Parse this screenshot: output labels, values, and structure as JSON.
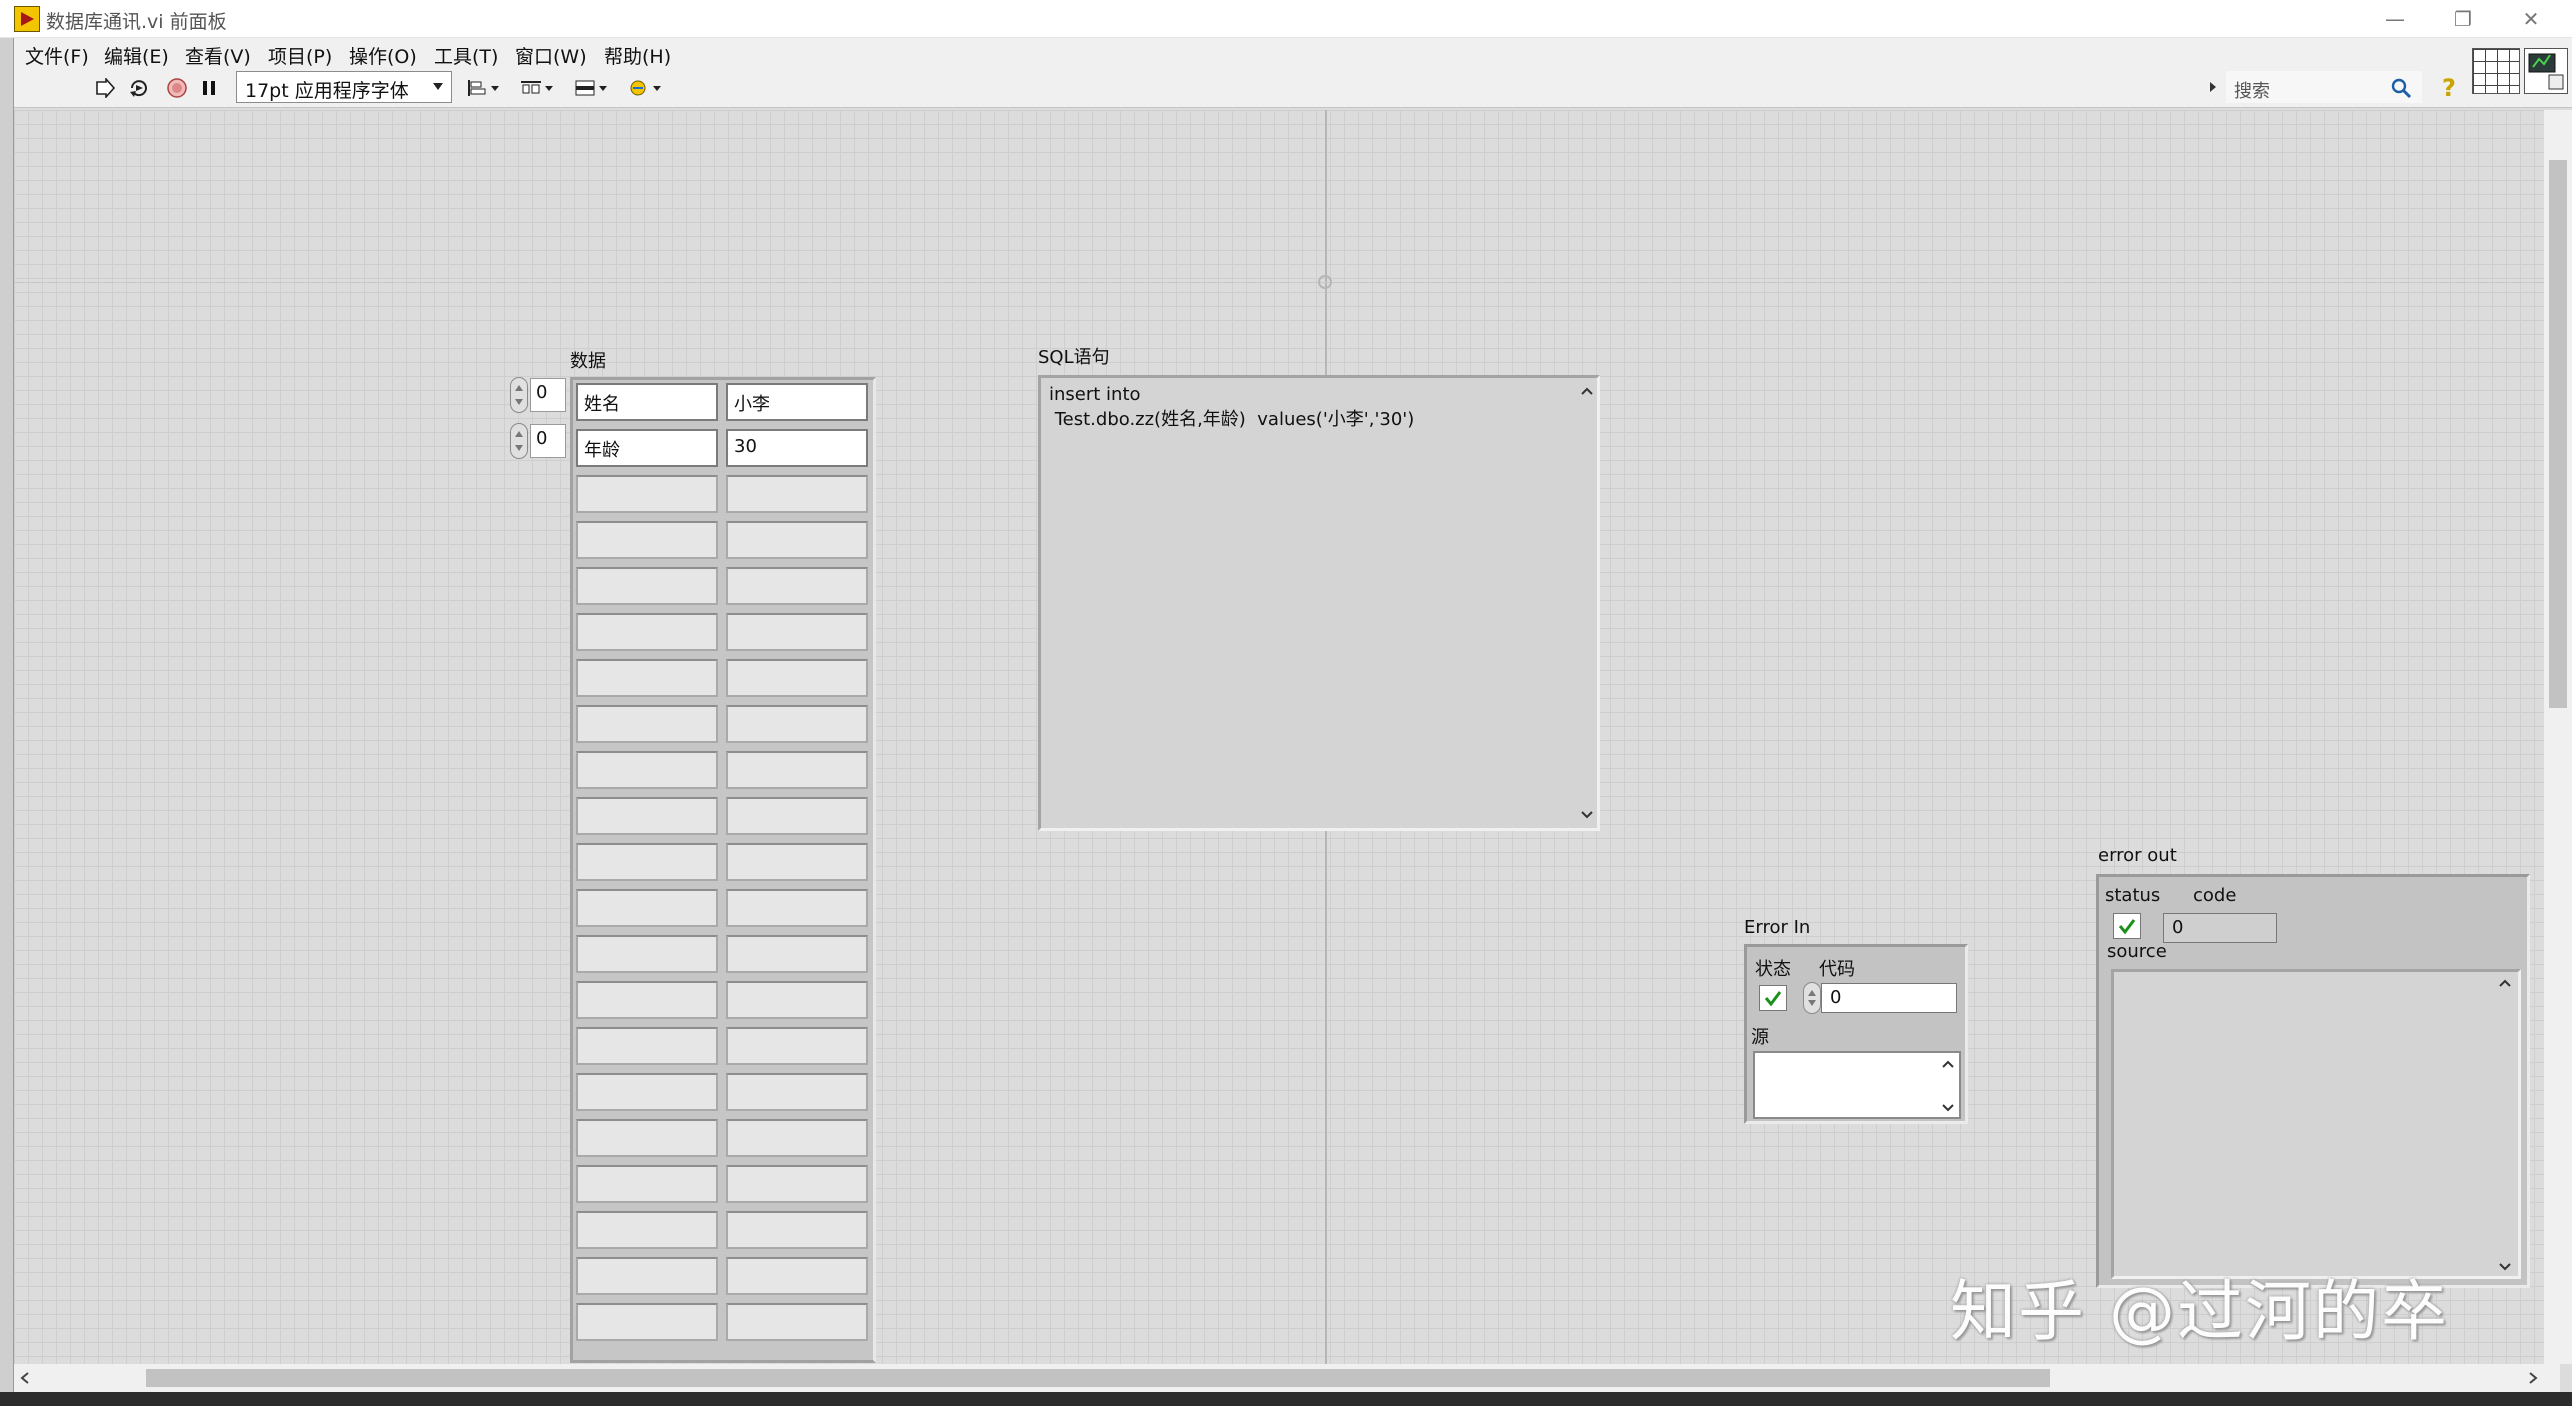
{
  "window": {
    "title": "数据库通讯.vi 前面板",
    "minimize": "—",
    "restore": "❐",
    "close": "✕"
  },
  "menu": [
    "文件(F)",
    "编辑(E)",
    "查看(V)",
    "项目(P)",
    "操作(O)",
    "工具(T)",
    "窗口(W)",
    "帮助(H)"
  ],
  "toolbar": {
    "font": "17pt 应用程序字体",
    "search_placeholder": "搜索",
    "help": "?"
  },
  "array": {
    "label": "数据",
    "index_row": "0",
    "index_col": "0",
    "rows": [
      [
        "姓名",
        "小李"
      ],
      [
        "年龄",
        "30"
      ]
    ]
  },
  "sql": {
    "label": "SQL语句",
    "text": "insert into\n Test.dbo.zz(姓名,年龄)  values('小李','30')"
  },
  "error_in": {
    "label": "Error In",
    "status_label": "状态",
    "code_label": "代码",
    "code": "0",
    "source_label": "源"
  },
  "error_out": {
    "label": "error out",
    "status_label": "status",
    "code_label": "code",
    "code": "0",
    "source_label": "source"
  },
  "watermark": "知乎 @过河的卒",
  "colors": {
    "app_icon": "#f3c400",
    "status_ok": "#1a8f1a"
  }
}
